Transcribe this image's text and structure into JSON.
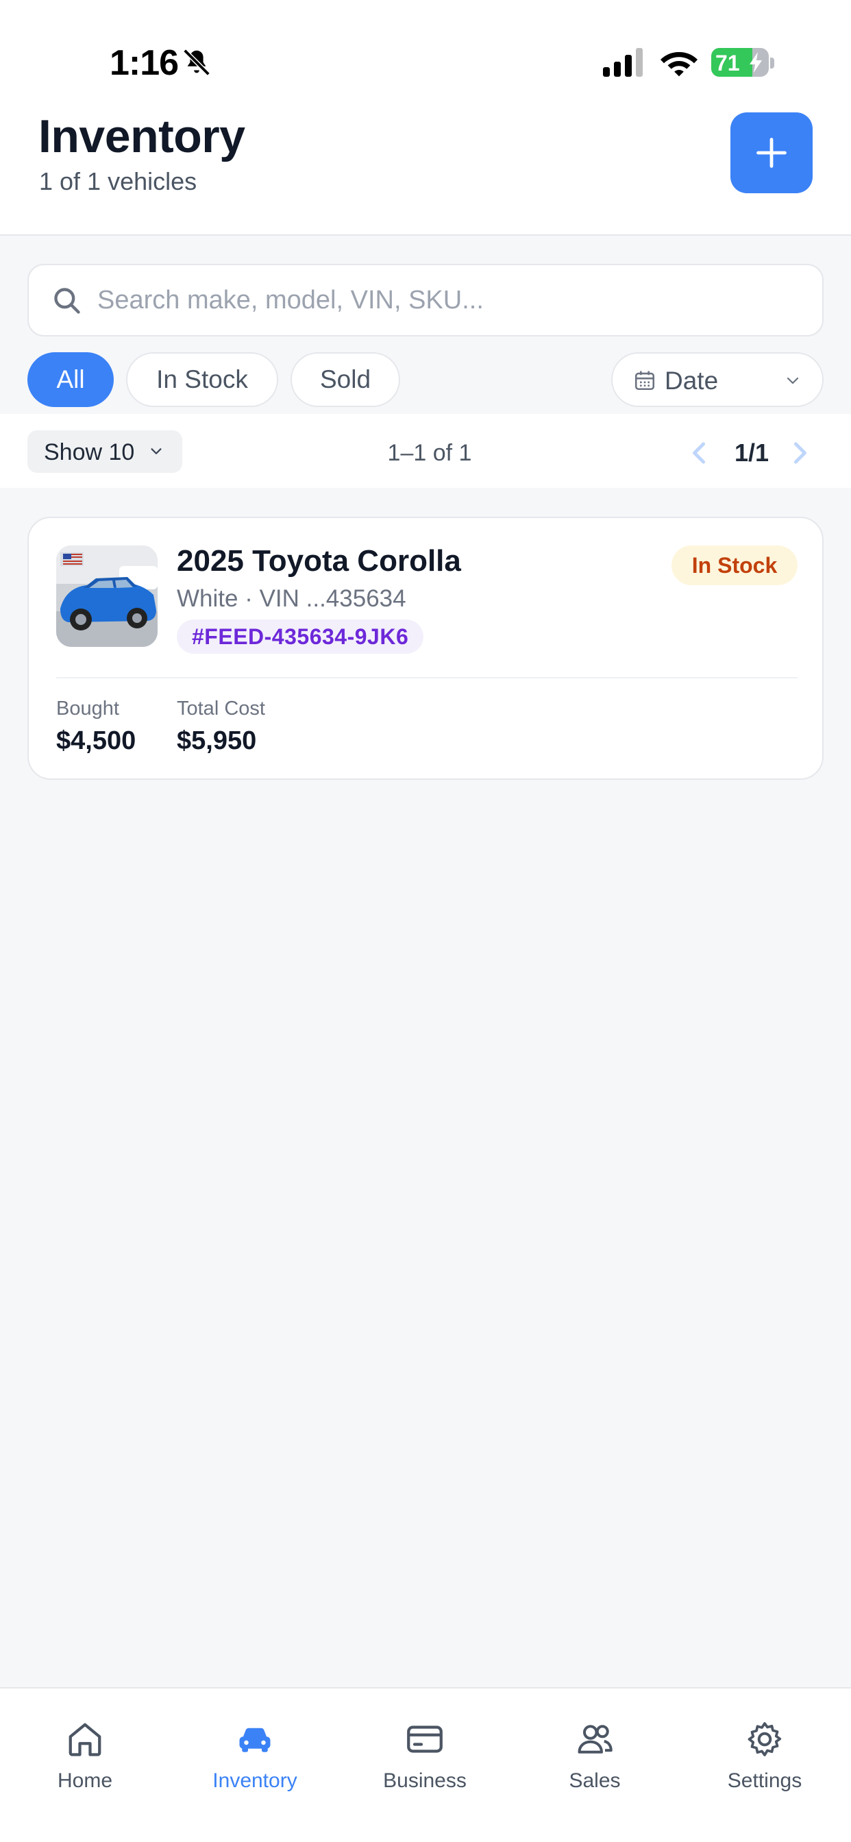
{
  "status_bar": {
    "time": "1:16",
    "battery_level": 71,
    "battery_text": "71",
    "icons": [
      "bell-slash-icon",
      "cellular-signal-icon",
      "wifi-icon",
      "battery-charging-icon"
    ]
  },
  "header": {
    "title": "Inventory",
    "subtitle": "1 of 1 vehicles",
    "add_icon": "plus-icon"
  },
  "search": {
    "placeholder": "Search make, model, VIN, SKU...",
    "value": ""
  },
  "filters": {
    "chips": [
      {
        "label": "All",
        "active": true
      },
      {
        "label": "In Stock",
        "active": false
      },
      {
        "label": "Sold",
        "active": false
      }
    ],
    "sort": {
      "label": "Date",
      "icon": "calendar-icon"
    }
  },
  "pagination": {
    "page_size_label": "Show 10",
    "range_text": "1–1 of 1",
    "page_indicator": "1/1"
  },
  "vehicles": [
    {
      "title": "2025 Toyota Corolla",
      "meta": "White · VIN ...435634",
      "sku": "#FEED-435634-9JK6",
      "status": "In Stock",
      "bought_label": "Bought",
      "bought_value": "$4,500",
      "total_cost_label": "Total Cost",
      "total_cost_value": "$5,950"
    }
  ],
  "tab_bar": {
    "tabs": [
      {
        "label": "Home",
        "icon": "home-icon",
        "active": false
      },
      {
        "label": "Inventory",
        "icon": "car-icon",
        "active": true
      },
      {
        "label": "Business",
        "icon": "credit-card-icon",
        "active": false
      },
      {
        "label": "Sales",
        "icon": "users-icon",
        "active": false
      },
      {
        "label": "Settings",
        "icon": "gear-icon",
        "active": false
      }
    ]
  },
  "colors": {
    "accent": "#3b82f6",
    "status_in_stock_bg": "#fef6dc",
    "status_in_stock_text": "#c2410c",
    "sku_tag_bg": "#f3f0fb",
    "sku_tag_text": "#6d28d9",
    "battery_green": "#34c759"
  }
}
